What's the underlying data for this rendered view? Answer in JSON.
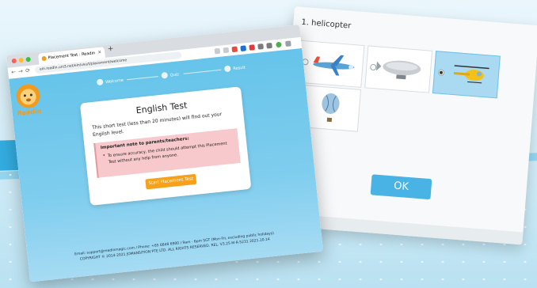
{
  "browser": {
    "tab_title": "Placement Test : Readin",
    "tab_close": "×",
    "new_tab": "+",
    "back": "←",
    "forward": "→",
    "reload": "⟳",
    "url": "ein.readin.uni3.net/ein/vsu/t/placement/welcome"
  },
  "app": {
    "logo_word": "Readin"
  },
  "steps": [
    {
      "label": "Welcome"
    },
    {
      "label": "Quiz"
    },
    {
      "label": "Result"
    }
  ],
  "card": {
    "title": "English Test",
    "description": "This short test (less than 20 minutes) will find out your English level.",
    "note_title": "Important note to parents/teachers:",
    "note_bullet": "•",
    "note_text": "To ensure accuracy, the child should attempt this Placement Test without any help from anyone.",
    "start_label": "Start Placement Test"
  },
  "footer": {
    "line1": "Email: support@readinmagic.com / Phone: +65 6848 6900 / 9am - 6pm SGT (Mon-Fri, excluding public holidays)",
    "line2": "COPYRIGHT © 2014-2021 JOMANSITION PTE LTD. ALL RIGHTS RESERVED. REL. V3.25 M-R-5231 2021.10.14"
  },
  "quiz": {
    "question": "1. helicopter",
    "options": [
      {
        "name": "airplane-image",
        "selected": false
      },
      {
        "name": "airship-image",
        "selected": false
      },
      {
        "name": "helicopter-image",
        "selected": true
      },
      {
        "name": "hot-air-balloon-image",
        "selected": false
      }
    ],
    "ok_label": "OK"
  },
  "colors": {
    "accent": "#4ab3e6",
    "start_button": "#f7a11a",
    "note_bg": "#f7c9cc",
    "content_bg": "#66c4ea"
  }
}
